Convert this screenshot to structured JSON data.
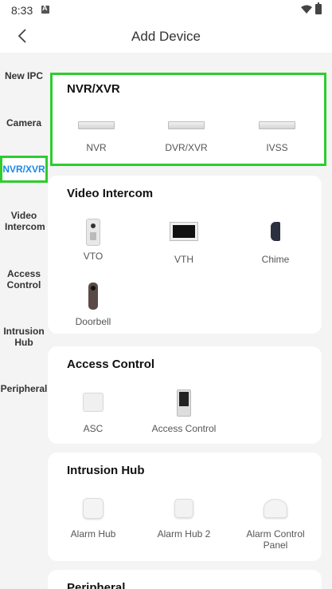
{
  "status_bar": {
    "time": "8:33"
  },
  "header": {
    "title": "Add Device"
  },
  "sidebar": {
    "items": [
      {
        "label": "New IPC"
      },
      {
        "label": "Camera"
      },
      {
        "label": "NVR/XVR"
      },
      {
        "label": "Video Intercom"
      },
      {
        "label": "Access Control"
      },
      {
        "label": "Intrusion Hub"
      },
      {
        "label": "Peripheral"
      }
    ],
    "active_color": "#1e88e5"
  },
  "sections": {
    "nvr": {
      "title": "NVR/XVR",
      "devices": [
        {
          "label": "NVR",
          "icon": "nvr-device-icon"
        },
        {
          "label": "DVR/XVR",
          "icon": "dvr-device-icon"
        },
        {
          "label": "IVSS",
          "icon": "ivss-device-icon"
        }
      ]
    },
    "intercom": {
      "title": "Video Intercom",
      "devices": [
        {
          "label": "VTO",
          "icon": "vto-device-icon"
        },
        {
          "label": "VTH",
          "icon": "vth-device-icon"
        },
        {
          "label": "Chime",
          "icon": "chime-device-icon"
        },
        {
          "label": "Doorbell",
          "icon": "doorbell-device-icon"
        }
      ]
    },
    "access": {
      "title": "Access Control",
      "devices": [
        {
          "label": "ASC",
          "icon": "asc-device-icon"
        },
        {
          "label": "Access Control",
          "icon": "access-control-device-icon"
        }
      ]
    },
    "intrusion": {
      "title": "Intrusion Hub",
      "devices": [
        {
          "label": "Alarm Hub",
          "icon": "alarm-hub-device-icon"
        },
        {
          "label": "Alarm Hub 2",
          "icon": "alarm-hub-2-device-icon"
        },
        {
          "label": "Alarm Control Panel",
          "icon": "alarm-control-panel-device-icon"
        }
      ]
    },
    "peripheral": {
      "title": "Peripheral"
    }
  },
  "highlight_color": "#2ecc2e"
}
